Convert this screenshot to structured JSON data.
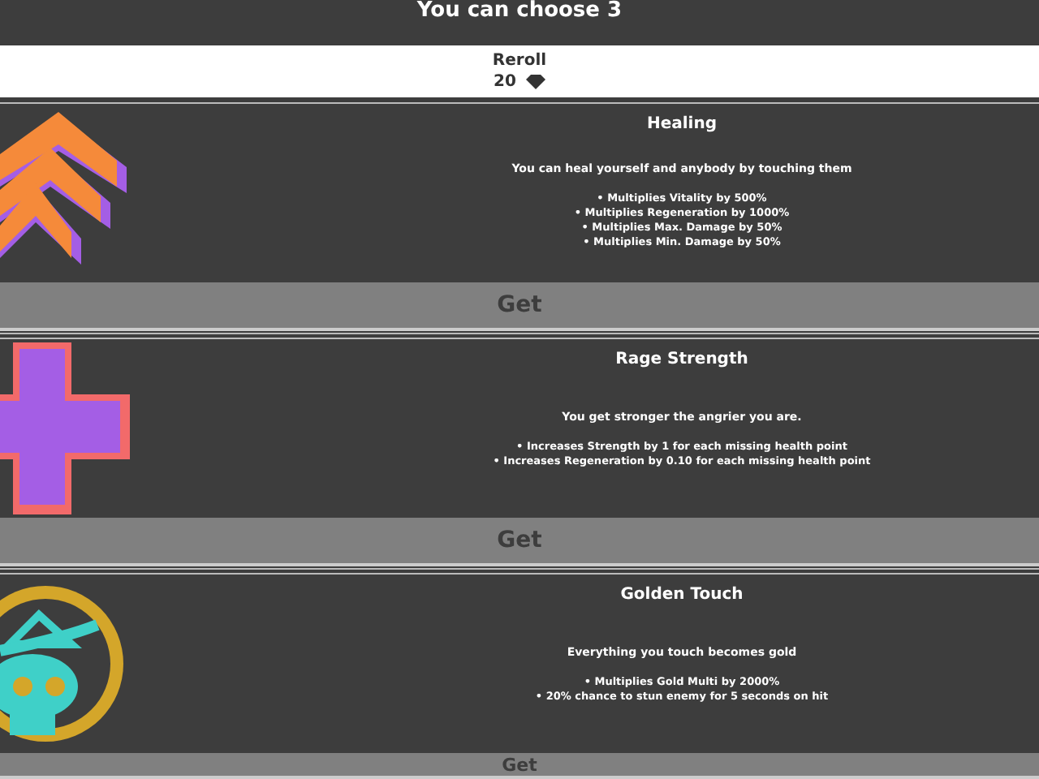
{
  "title": "You can choose 3",
  "reroll": {
    "label": "Reroll",
    "cost": "20"
  },
  "perks": [
    {
      "kind": "chevrons",
      "name": "Healing",
      "description": "You can heal yourself and anybody by touching them",
      "effects": [
        "• Multiplies Vitality by 500%",
        "• Multiplies Regeneration by 1000%",
        "• Multiplies Max. Damage by 50%",
        "• Multiplies Min. Damage by 50%"
      ],
      "button": "Get"
    },
    {
      "kind": "cross",
      "name": "Rage Strength",
      "description": "You get stronger the angrier you are.",
      "effects": [
        "• Increases Strength by 1 for each missing health point",
        "• Increases Regeneration by 0.10 for each missing health point"
      ],
      "button": "Get"
    },
    {
      "kind": "skull",
      "name": "Golden Touch",
      "description": "Everything you touch becomes gold",
      "effects": [
        "• Multiplies Gold Multi by 2000%",
        "• 20% chance to stun enemy for 5 seconds on hit"
      ],
      "button": "Get"
    }
  ]
}
